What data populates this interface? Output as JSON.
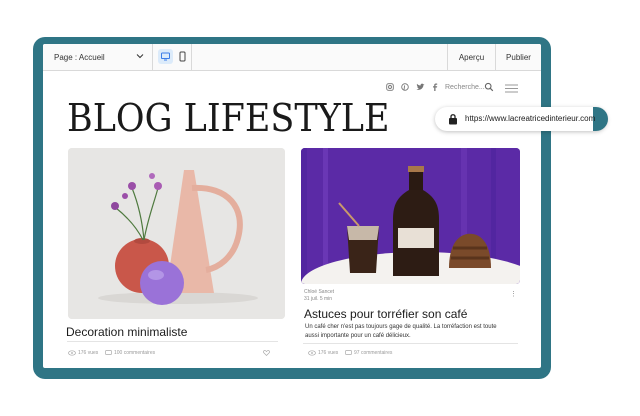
{
  "toolbar": {
    "page_label": "Page : Accueil",
    "preview_label": "Aperçu",
    "publish_label": "Publier"
  },
  "site": {
    "search_placeholder": "Recherche...",
    "blog_title": "BLOG LIFESTYLE",
    "social_icons": [
      "instagram-icon",
      "pinterest-icon",
      "twitter-icon",
      "facebook-icon"
    ]
  },
  "posts": [
    {
      "title": "Decoration minimaliste",
      "views": "176 vues",
      "comments": "100 commentaires"
    },
    {
      "author": "Chloé Sancet",
      "date": "31 juil. 5 min",
      "title": "Astuces pour torréfier son café",
      "excerpt": "Un café cher n'est pas toujours gage de qualité. La torréfaction est toute aussi importante pour un café délicieux.",
      "views": "176 vues",
      "comments": "97 commentaires"
    }
  ],
  "url_badge": {
    "url": "https://www.lacreatricedinterieur.com"
  },
  "colors": {
    "frame": "#2f7585",
    "post2_background": "#5b2aa6"
  }
}
